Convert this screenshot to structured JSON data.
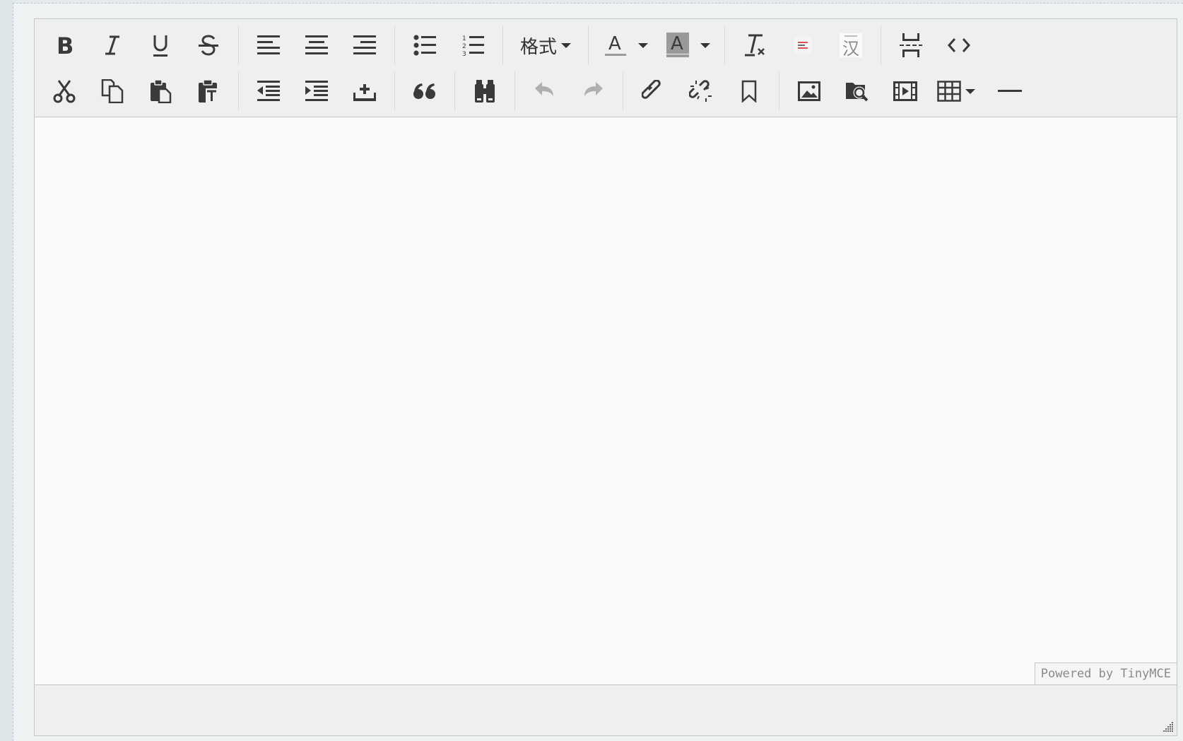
{
  "toolbar": {
    "format_menu_label": "格式",
    "row1": [
      {
        "name": "bold-button",
        "icon": "bold-icon"
      },
      {
        "name": "italic-button",
        "icon": "italic-icon"
      },
      {
        "name": "underline-button",
        "icon": "underline-icon"
      },
      {
        "name": "strikethrough-button",
        "icon": "strikethrough-icon"
      },
      {
        "name": "align-left-button",
        "icon": "align-left-icon"
      },
      {
        "name": "align-center-button",
        "icon": "align-center-icon"
      },
      {
        "name": "align-right-button",
        "icon": "align-right-icon"
      },
      {
        "name": "bullet-list-button",
        "icon": "bullet-list-icon"
      },
      {
        "name": "numbered-list-button",
        "icon": "numbered-list-icon"
      },
      {
        "name": "format-menu-button",
        "icon": "chevron-down-icon"
      },
      {
        "name": "text-color-button",
        "icon": "text-color-icon"
      },
      {
        "name": "background-color-button",
        "icon": "background-color-icon"
      },
      {
        "name": "clear-formatting-button",
        "icon": "clear-formatting-icon"
      },
      {
        "name": "code-sample-button",
        "icon": "code-sample-icon"
      },
      {
        "name": "chinese-convert-button",
        "icon": "chinese-character-icon"
      },
      {
        "name": "page-break-button",
        "icon": "page-break-icon"
      },
      {
        "name": "source-code-button",
        "icon": "source-code-icon"
      }
    ],
    "row2": [
      {
        "name": "cut-button",
        "icon": "scissors-icon"
      },
      {
        "name": "copy-button",
        "icon": "copy-icon"
      },
      {
        "name": "paste-button",
        "icon": "paste-icon"
      },
      {
        "name": "paste-as-text-button",
        "icon": "paste-text-icon"
      },
      {
        "name": "outdent-button",
        "icon": "outdent-icon"
      },
      {
        "name": "indent-button",
        "icon": "indent-icon"
      },
      {
        "name": "insert-button",
        "icon": "upload-icon"
      },
      {
        "name": "blockquote-button",
        "icon": "quote-icon"
      },
      {
        "name": "find-replace-button",
        "icon": "binoculars-icon"
      },
      {
        "name": "undo-button",
        "icon": "undo-icon",
        "disabled": true
      },
      {
        "name": "redo-button",
        "icon": "redo-icon",
        "disabled": true
      },
      {
        "name": "insert-link-button",
        "icon": "link-icon"
      },
      {
        "name": "remove-link-button",
        "icon": "unlink-icon"
      },
      {
        "name": "anchor-button",
        "icon": "bookmark-icon"
      },
      {
        "name": "insert-image-button",
        "icon": "image-icon"
      },
      {
        "name": "file-browser-button",
        "icon": "folder-search-icon"
      },
      {
        "name": "insert-media-button",
        "icon": "film-icon"
      },
      {
        "name": "table-button",
        "icon": "table-icon"
      },
      {
        "name": "horizontal-rule-button",
        "icon": "horizontal-line-icon"
      }
    ],
    "text_color_letter": "A",
    "bg_color_letter": "A",
    "chinese_label": "汉"
  },
  "editor": {
    "content": "",
    "branding": "Powered by TinyMCE"
  },
  "colors": {
    "toolbar_bg": "#eef0ef",
    "content_bg": "#f9fbfa",
    "border": "#c5c5c5",
    "icon": "#3a3a3a",
    "code_sample_accent": "#d9534f"
  }
}
